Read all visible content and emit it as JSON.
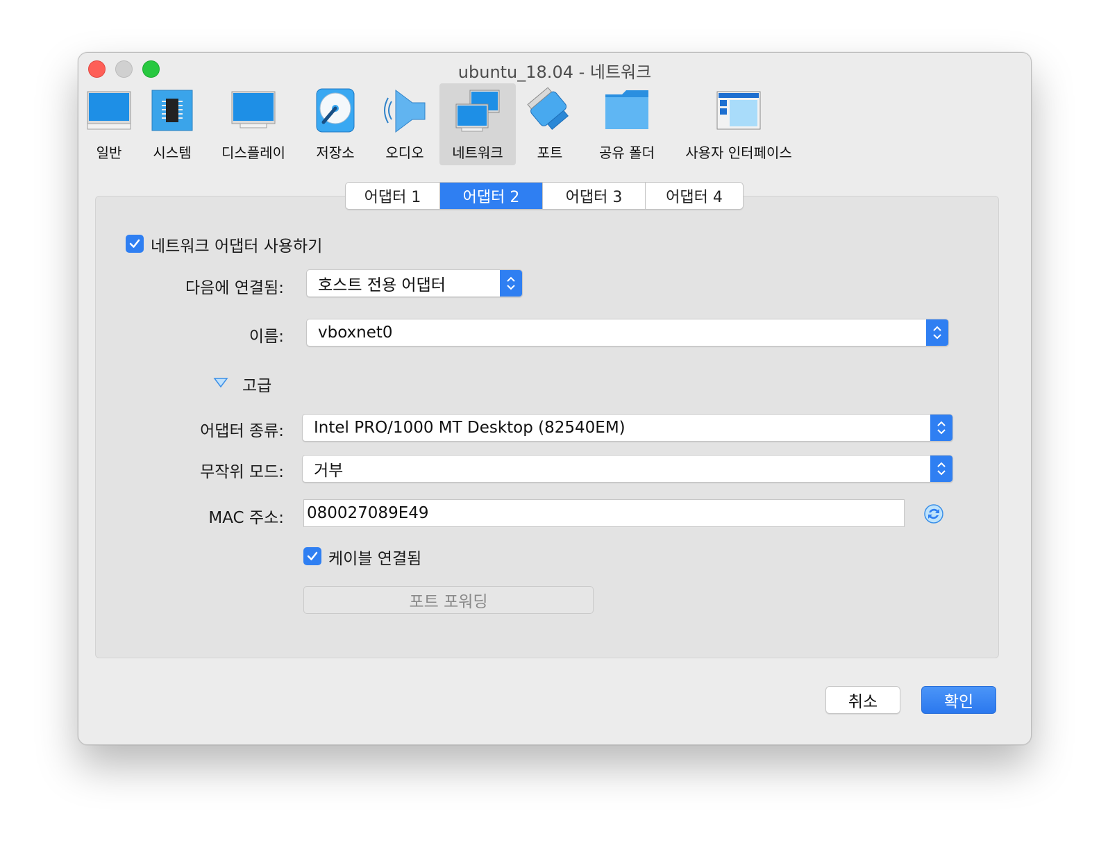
{
  "window": {
    "title": "ubuntu_18.04 - 네트워크"
  },
  "toolbar": {
    "items": [
      {
        "label": "일반",
        "icon": "general-monitor-icon"
      },
      {
        "label": "시스템",
        "icon": "system-chip-icon"
      },
      {
        "label": "디스플레이",
        "icon": "display-monitor-icon"
      },
      {
        "label": "저장소",
        "icon": "storage-disk-icon"
      },
      {
        "label": "오디오",
        "icon": "audio-speaker-icon"
      },
      {
        "label": "네트워크",
        "icon": "network-icon",
        "active": true
      },
      {
        "label": "포트",
        "icon": "serial-port-icon"
      },
      {
        "label": "공유 폴더",
        "icon": "shared-folder-icon"
      },
      {
        "label": "사용자 인터페이스",
        "icon": "user-interface-icon"
      }
    ]
  },
  "tabs": [
    {
      "label": "어댑터 1"
    },
    {
      "label": "어댑터 2",
      "active": true
    },
    {
      "label": "어댑터 3"
    },
    {
      "label": "어댑터 4"
    }
  ],
  "form": {
    "enable_adapter": {
      "label": "네트워크 어댑터 사용하기",
      "checked": true
    },
    "attached_to": {
      "label": "다음에 연결됨:",
      "value": "호스트 전용 어댑터"
    },
    "name": {
      "label": "이름:",
      "value": "vboxnet0"
    },
    "advanced": {
      "label": "고급"
    },
    "adapter_type": {
      "label": "어댑터 종류:",
      "value": "Intel PRO/1000 MT Desktop (82540EM)"
    },
    "promiscuous": {
      "label": "무작위 모드:",
      "value": "거부"
    },
    "mac": {
      "label": "MAC 주소:",
      "value": "080027089E49"
    },
    "cable_connected": {
      "label": "케이블 연결됨",
      "checked": true
    },
    "port_forwarding": {
      "label": "포트 포워딩"
    }
  },
  "buttons": {
    "cancel": "취소",
    "ok": "확인"
  },
  "colors": {
    "accent": "#2f7ff2",
    "window_bg": "#ececec",
    "panel_bg": "#e3e3e3"
  }
}
